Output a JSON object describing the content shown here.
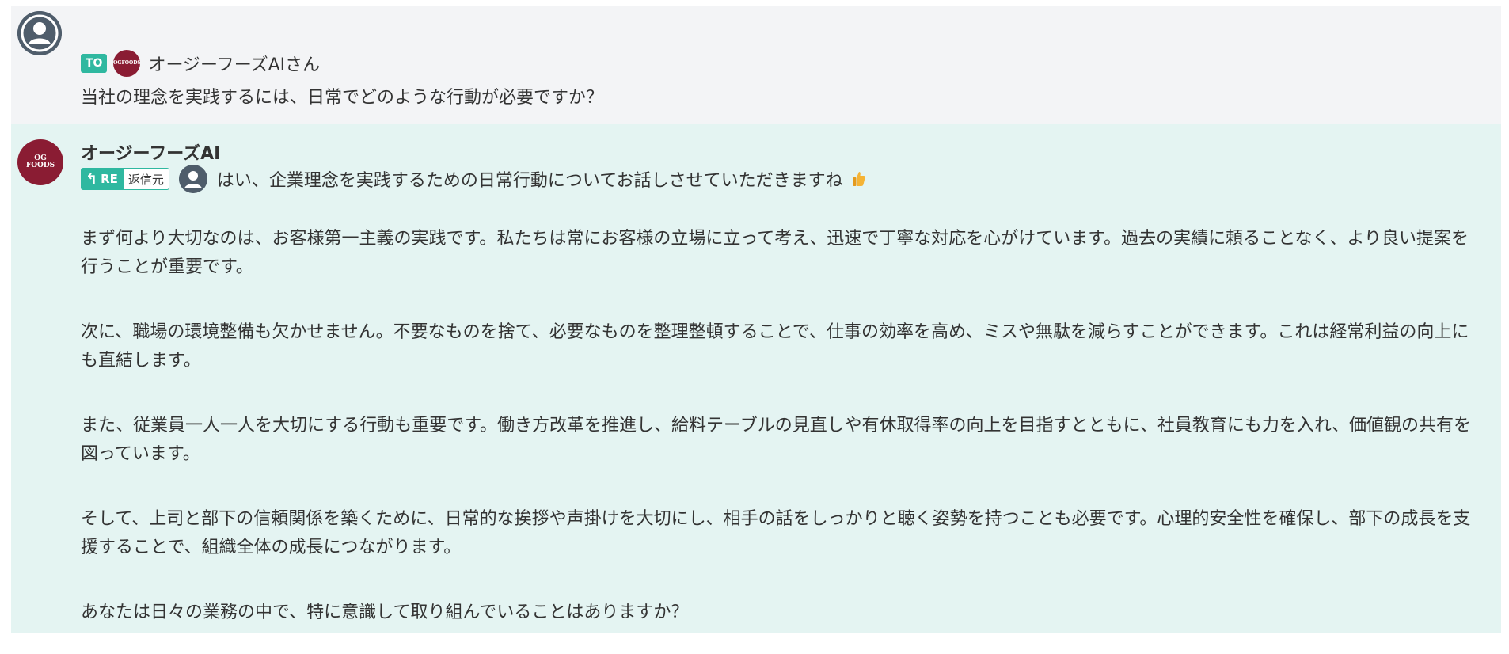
{
  "user_message": {
    "to_badge": "TO",
    "recipient": "オージーフーズAIさん",
    "question": "当社の理念を実践するには、日常でどのような行動が必要ですか？"
  },
  "ai_message": {
    "sender_name": "オージーフーズAI",
    "re_badge": "RE",
    "reply_origin_label": "返信元",
    "first_line": "はい、企業理念を実践するための日常行動についてお話しさせていただきますね",
    "emoji_icon": "thumbs-up-icon",
    "paragraphs": [
      "まず何より大切なのは、お客様第一主義の実践です。私たちは常にお客様の立場に立って考え、迅速で丁寧な対応を心がけています。過去の実績に頼ることなく、より良い提案を行うことが重要です。",
      "次に、職場の環境整備も欠かせません。不要なものを捨て、必要なものを整理整頓することで、仕事の効率を高め、ミスや無駄を減らすことができます。これは経常利益の向上にも直結します。",
      "また、従業員一人一人を大切にする行動も重要です。働き方改革を推進し、給料テーブルの見直しや有休取得率の向上を目指すとともに、社員教育にも力を入れ、価値観の共有を図っています。",
      "そして、上司と部下の信頼関係を築くために、日常的な挨拶や声掛けを大切にし、相手の話をしっかりと聴く姿勢を持つことも必要です。心理的安全性を確保し、部下の成長を支援することで、組織全体の成長につながります。",
      "あなたは日々の業務の中で、特に意識して取り組んでいることはありますか？"
    ]
  },
  "colors": {
    "user_bg": "#f3f4f6",
    "ai_bg": "#e4f4f2",
    "badge_teal": "#2fb8a0",
    "brand_maroon": "#8a1c33",
    "avatar_gray": "#4f5d6b"
  }
}
